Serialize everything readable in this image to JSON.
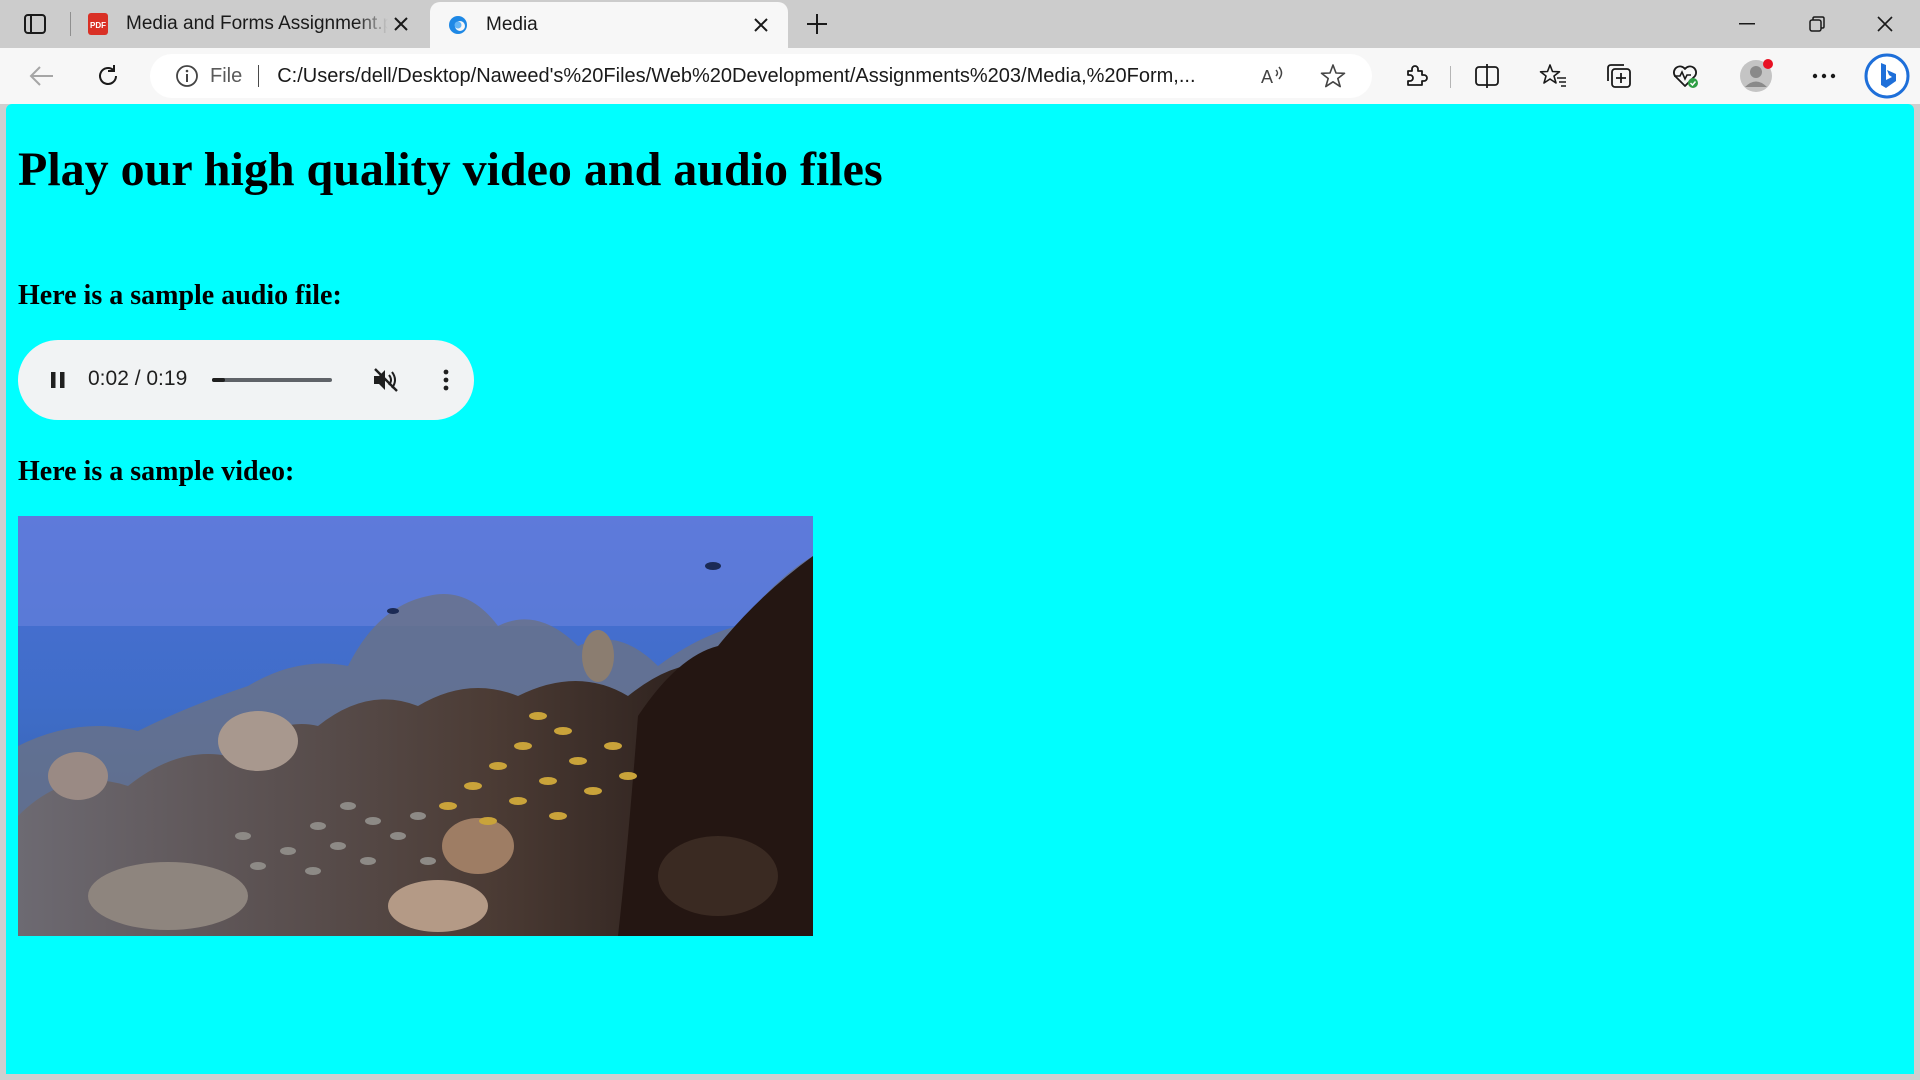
{
  "browser": {
    "tabs": [
      {
        "title": "Media and Forms Assignment.pdf",
        "type": "pdf",
        "active": false
      },
      {
        "title": "Media",
        "type": "web",
        "active": true
      }
    ],
    "address": {
      "scheme_label": "File",
      "url": "C:/Users/dell/Desktop/Naweed's%20Files/Web%20Development/Assignments%203/Media,%20Form,..."
    },
    "icons": {
      "tab_actions": "tab-actions-icon",
      "pdf": "pdf-icon",
      "edge": "edge-icon",
      "close": "close-icon",
      "new_tab": "plus-icon",
      "minimize": "minimize-icon",
      "restore": "restore-icon",
      "back": "back-arrow-icon",
      "refresh": "refresh-icon",
      "info": "info-icon",
      "read_aloud": "read-aloud-icon",
      "favorite": "star-icon",
      "extensions": "puzzle-icon",
      "split_screen": "split-screen-icon",
      "favorites": "favorites-icon",
      "collections": "collections-icon",
      "browser_essentials": "heart-pulse-icon",
      "profile": "profile-avatar-icon",
      "more": "more-icon",
      "copilot": "bing-icon"
    },
    "colors": {
      "tabstrip": "#cccccc",
      "toolbar": "#f7f7f7",
      "page_background": "#00ffff",
      "profile_dot": "#e81123"
    }
  },
  "page": {
    "heading": "Play our high quality video and audio files",
    "audio_label": "Here is a sample audio file:",
    "video_label": "Here is a sample video:",
    "audio_player": {
      "time": "0:02 / 0:19",
      "progress": 0.105,
      "state": "playing",
      "muted": true
    },
    "video": {
      "content": "underwater coral reef with a school of yellow-striped fish"
    }
  }
}
